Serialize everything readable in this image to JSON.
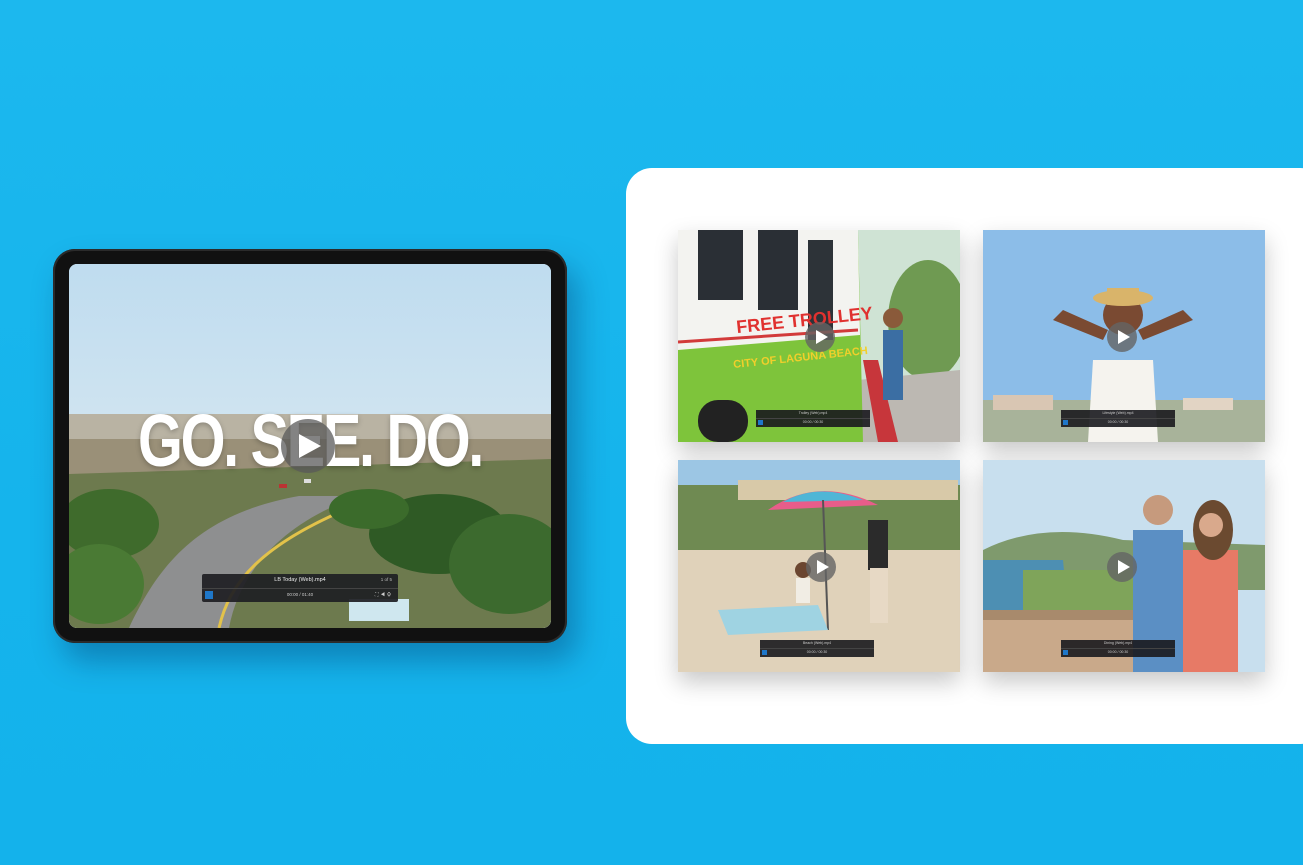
{
  "hero": {
    "headline": "GO. SEE. DO.",
    "player": {
      "title": "LB Today (Web).mp4",
      "count": "1 of 5",
      "time": "00:00 / 01:40"
    }
  },
  "gallery": {
    "tiles": [
      {
        "id": "trolley",
        "bar_title": "Trolley (Web).mp4",
        "bar_time": "00:00 / 00:30",
        "sign_text": "FREE TROLLEY",
        "sign_text_2": "CITY OF LAGUNA BEACH"
      },
      {
        "id": "hat",
        "bar_title": "Lifestyle (Web).mp4",
        "bar_time": "00:00 / 00:30"
      },
      {
        "id": "beach",
        "bar_title": "Beach (Web).mp4",
        "bar_time": "00:00 / 00:30"
      },
      {
        "id": "couple",
        "bar_title": "Dining (Web).mp4",
        "bar_time": "00:00 / 00:30"
      }
    ]
  },
  "colors": {
    "background": "#17b5ed",
    "panel": "#ffffff",
    "accent_blue": "#1f77c9"
  },
  "icons": [
    "play-icon",
    "fullscreen-icon",
    "volume-icon"
  ]
}
